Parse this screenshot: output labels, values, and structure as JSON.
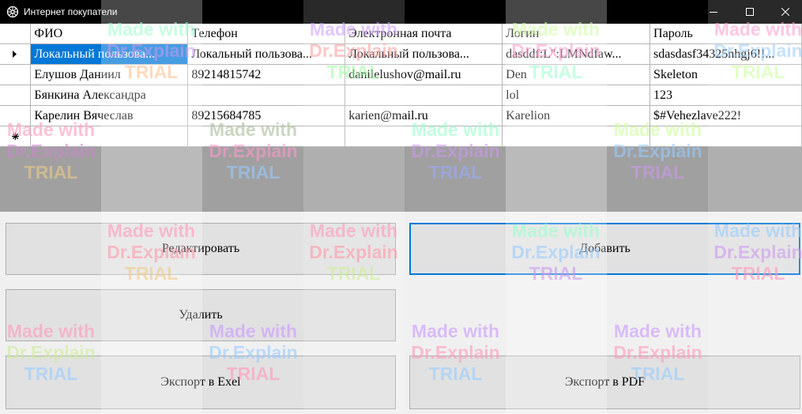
{
  "window": {
    "title": "Интернет покупатели",
    "icons": {
      "app": "app-icon",
      "minimize": "minimize-icon",
      "maximize": "maximize-icon",
      "close": "close-icon"
    }
  },
  "grid": {
    "columns": [
      "ФИО",
      "Телефон",
      "Электронная почта",
      "Логин",
      "Пароль"
    ],
    "rows": [
      [
        "Локальный пользова...",
        "Локальный пользова...",
        "Локальный пользова...",
        "dasddf:L\":LMNdfaw...",
        "sdasdasf34325nhgj6!!..."
      ],
      [
        "Елушов Даниил",
        "89214815742",
        "danilelushov@mail.ru",
        "Den",
        "Skeleton"
      ],
      [
        "Бянкина Александра",
        "",
        "",
        "lol",
        "123"
      ],
      [
        "Карелин Вячеслав",
        "89215684785",
        "karien@mail.ru",
        "Karelion",
        "$#Vehezlave222!"
      ],
      [
        "",
        "",
        "",
        "",
        ""
      ]
    ],
    "selected_row": 0,
    "current_row_marker": "row-arrow-icon",
    "new_row_marker": "new-row-icon"
  },
  "buttons": {
    "edit": "Редактировать",
    "add": "Добавить",
    "delete": "Удалить",
    "export_excel": "Экспорт в Exel",
    "export_pdf": "Экспорт в PDF"
  },
  "watermark": {
    "line1": "Made with",
    "line2": "Dr.Explain",
    "line3": "TRIAL"
  },
  "colors": {
    "selection": "#0078d7",
    "focus_border": "#0078d7",
    "grid_background": "#a0a0a0",
    "titlebar": "#000000"
  }
}
